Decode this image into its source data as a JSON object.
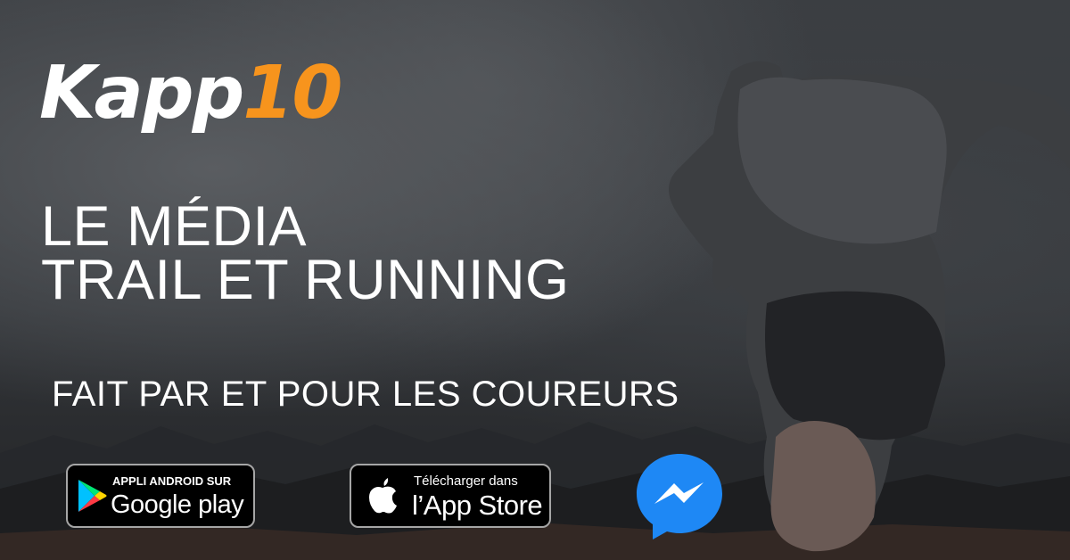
{
  "brand": {
    "part1": "Kapp",
    "part2": "10",
    "accent_color": "#f7941d"
  },
  "headline": {
    "line1": "LE MÉDIA",
    "line2": "TRAIL ET RUNNING"
  },
  "tagline": "FAIT PAR ET POUR LES COUREURS",
  "badges": {
    "google": {
      "top_text": "APPLI ANDROID SUR",
      "main_text": "Google play",
      "icon": "google-play-icon"
    },
    "apple": {
      "top_text": "Télécharger dans",
      "main_text": "l’App Store",
      "icon": "apple-icon"
    },
    "messenger": {
      "icon": "messenger-icon",
      "color": "#1e88f5"
    }
  }
}
